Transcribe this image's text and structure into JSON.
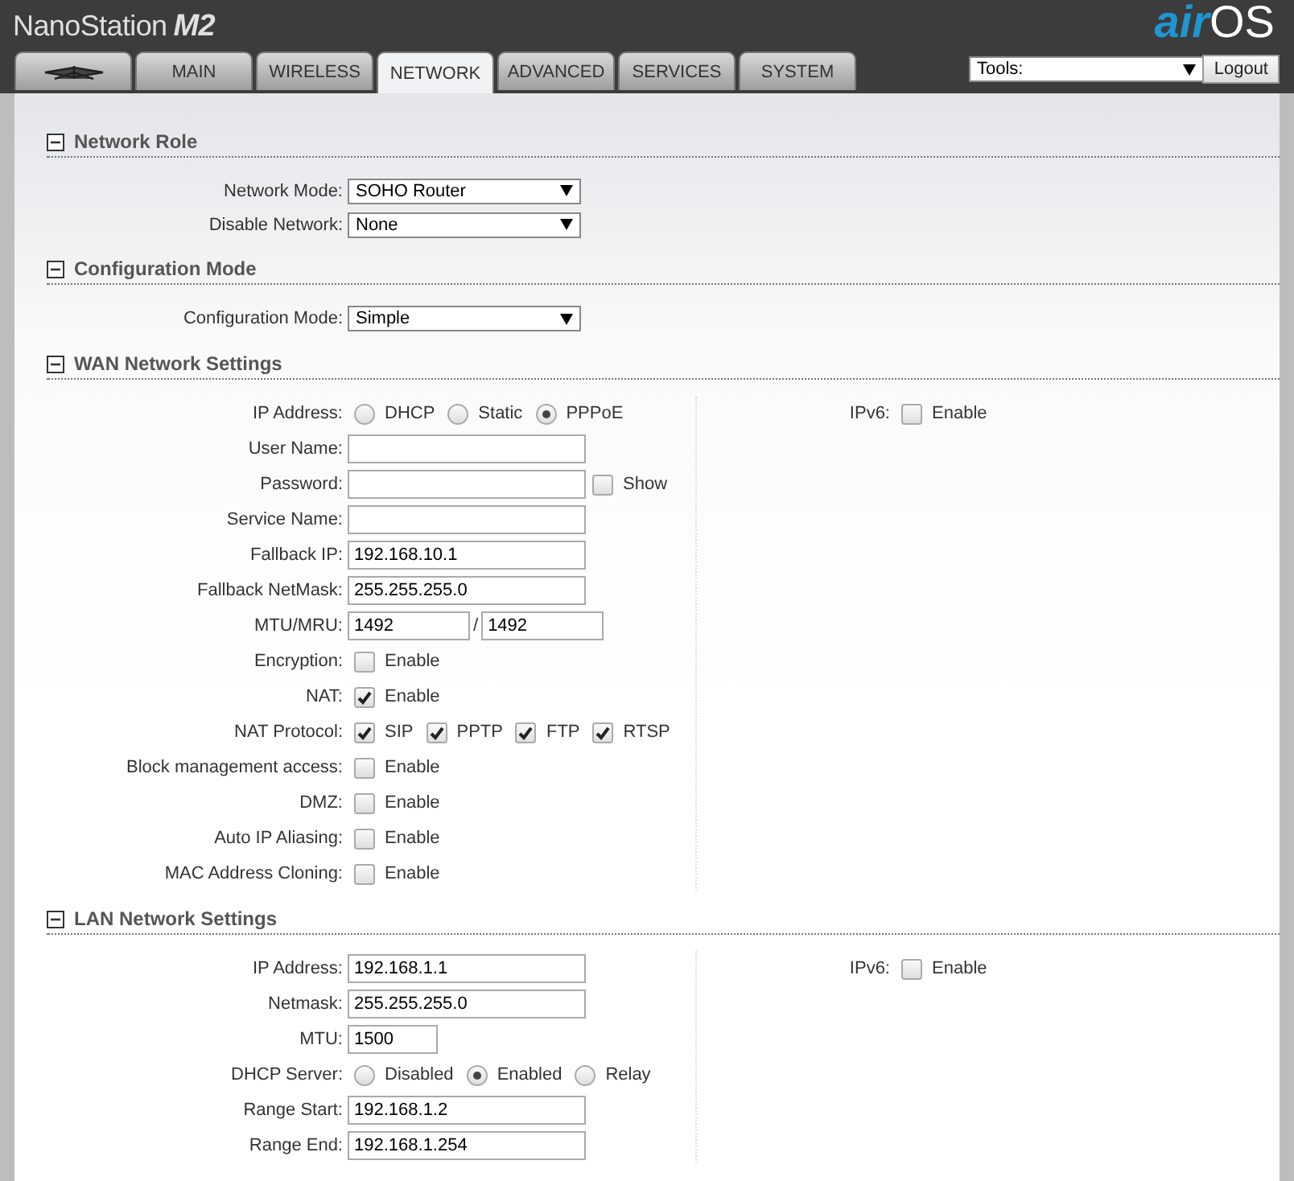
{
  "header": {
    "product": "NanoStation",
    "model": "M2",
    "brand_left": "air",
    "brand_right": "OS"
  },
  "tabs": [
    {
      "kind": "logo",
      "selected": false
    },
    {
      "kind": "text",
      "label": "MAIN",
      "selected": false
    },
    {
      "kind": "text",
      "label": "WIRELESS",
      "selected": false
    },
    {
      "kind": "text",
      "label": "NETWORK",
      "selected": true
    },
    {
      "kind": "text",
      "label": "ADVANCED",
      "selected": false
    },
    {
      "kind": "text",
      "label": "SERVICES",
      "selected": false
    },
    {
      "kind": "text",
      "label": "SYSTEM",
      "selected": false
    }
  ],
  "tools": {
    "value": "Tools:"
  },
  "logout": "Logout",
  "sections": [
    {
      "title": "Network Role",
      "expanded": true,
      "rows": [
        {
          "kind": "select",
          "label": "Network Mode:",
          "value": "SOHO Router"
        },
        {
          "kind": "select",
          "label": "Disable Network:",
          "value": "None"
        }
      ]
    },
    {
      "title": "Configuration Mode",
      "expanded": true,
      "rows": [
        {
          "kind": "select",
          "label": "Configuration Mode:",
          "value": "Simple"
        }
      ]
    },
    {
      "title": "WAN Network Settings",
      "expanded": true,
      "rows": [
        {
          "kind": "radios",
          "label": "IP Address:",
          "options": [
            {
              "label": "DHCP",
              "selected": false
            },
            {
              "label": "Static",
              "selected": false
            },
            {
              "label": "PPPoE",
              "selected": true
            }
          ]
        },
        {
          "kind": "text",
          "label": "User Name:"
        },
        {
          "kind": "text_check",
          "label": "Password:",
          "options": [
            {
              "label": "Show",
              "checked": false
            }
          ]
        },
        {
          "kind": "text",
          "label": "Service Name:"
        },
        {
          "kind": "text",
          "label": "Fallback IP:",
          "value": "192.168.10.1"
        },
        {
          "kind": "text",
          "label": "Fallback NetMask:",
          "value": "255.255.255.0"
        },
        {
          "kind": "pair",
          "label": "MTU/MRU:",
          "values": [
            "1492",
            "1492"
          ],
          "separator": "/"
        },
        {
          "kind": "checks",
          "label": "Encryption:",
          "options": [
            {
              "label": "Enable",
              "checked": false
            }
          ]
        },
        {
          "kind": "checks",
          "label": "NAT:",
          "options": [
            {
              "label": "Enable",
              "checked": true
            }
          ]
        },
        {
          "kind": "checks",
          "label": "NAT Protocol:",
          "options": [
            {
              "label": "SIP",
              "checked": true
            },
            {
              "label": "PPTP",
              "checked": true
            },
            {
              "label": "FTP",
              "checked": true
            },
            {
              "label": "RTSP",
              "checked": true
            }
          ]
        },
        {
          "kind": "checks",
          "label": "Block management access:",
          "options": [
            {
              "label": "Enable",
              "checked": false
            }
          ]
        },
        {
          "kind": "checks",
          "label": "DMZ:",
          "options": [
            {
              "label": "Enable",
              "checked": false
            }
          ]
        },
        {
          "kind": "checks",
          "label": "Auto IP Aliasing:",
          "options": [
            {
              "label": "Enable",
              "checked": false
            }
          ]
        },
        {
          "kind": "checks",
          "label": "MAC Address Cloning:",
          "options": [
            {
              "label": "Enable",
              "checked": false
            }
          ]
        }
      ],
      "side_rows": [
        {
          "kind": "checks",
          "label": "IPv6:",
          "options": [
            {
              "label": "Enable",
              "checked": false
            }
          ]
        }
      ]
    },
    {
      "title": "LAN Network Settings",
      "expanded": true,
      "rows": [
        {
          "kind": "text",
          "label": "IP Address:",
          "value": "192.168.1.1"
        },
        {
          "kind": "text",
          "label": "Netmask:",
          "value": "255.255.255.0"
        },
        {
          "kind": "short_text",
          "label": "MTU:",
          "value": "1500"
        },
        {
          "kind": "radios",
          "label": "DHCP Server:",
          "options": [
            {
              "label": "Disabled",
              "selected": false
            },
            {
              "label": "Enabled",
              "selected": true
            },
            {
              "label": "Relay",
              "selected": false
            }
          ]
        },
        {
          "kind": "text",
          "label": "Range Start:",
          "value": "192.168.1.2"
        },
        {
          "kind": "text",
          "label": "Range End:",
          "value": "192.168.1.254"
        }
      ],
      "side_rows": [
        {
          "kind": "checks",
          "label": "IPv6:",
          "options": [
            {
              "label": "Enable",
              "checked": false
            }
          ]
        }
      ]
    }
  ]
}
